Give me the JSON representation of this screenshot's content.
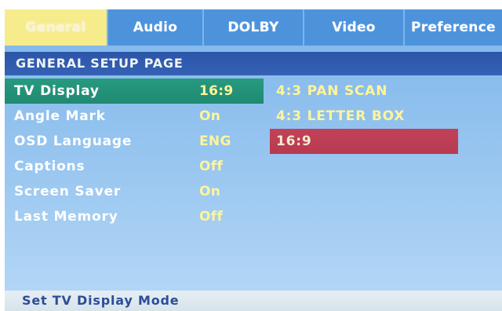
{
  "tabs": [
    {
      "label": "General",
      "active": true
    },
    {
      "label": "Audio",
      "active": false
    },
    {
      "label": "DOLBY",
      "active": false
    },
    {
      "label": "Video",
      "active": false
    },
    {
      "label": "Preference",
      "active": false
    }
  ],
  "page_heading": "GENERAL SETUP PAGE",
  "settings": [
    {
      "label": "TV Display",
      "value": "16:9",
      "selected": true
    },
    {
      "label": "Angle Mark",
      "value": "On",
      "selected": false
    },
    {
      "label": "OSD Language",
      "value": "ENG",
      "selected": false
    },
    {
      "label": "Captions",
      "value": "Off",
      "selected": false
    },
    {
      "label": "Screen Saver",
      "value": "On",
      "selected": false
    },
    {
      "label": "Last Memory",
      "value": "Off",
      "selected": false
    }
  ],
  "options": [
    {
      "label": "4:3 PAN SCAN",
      "highlighted": false
    },
    {
      "label": "4:3 LETTER BOX",
      "highlighted": false
    },
    {
      "label": "16:9",
      "highlighted": true
    }
  ],
  "status_text": "Set TV Display Mode",
  "colors": {
    "screen_background": "#95c4ef",
    "tab_background": "#4d93dc",
    "active_tab": "#f6ec8c",
    "heading_bar": "#3562b4",
    "selected_row": "#1f8a71",
    "highlighted_option": "#b73a52",
    "value_text": "#fff59a",
    "status_bar": "#d7e3ea",
    "status_text": "#2b4d99"
  }
}
